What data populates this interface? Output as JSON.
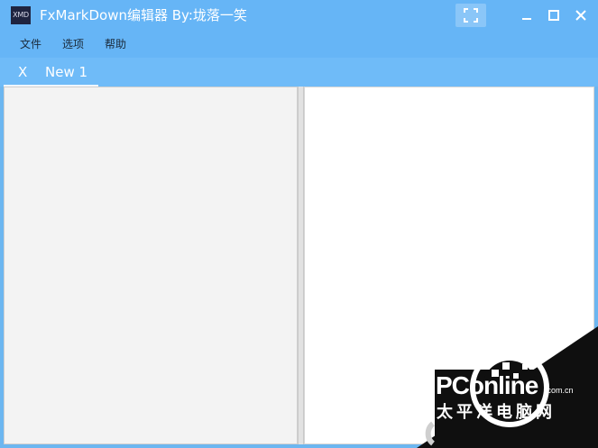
{
  "window": {
    "icon_text": "XMD",
    "title": "FxMarkDown编辑器  By:垅落一笑"
  },
  "menu": {
    "items": [
      "文件",
      "选项",
      "帮助"
    ]
  },
  "tabs": [
    {
      "close_label": "X",
      "label": "New 1"
    }
  ],
  "watermark": {
    "brand": "PConline",
    "domain": ".com.cn",
    "cn_text": "太平洋电脑网"
  },
  "colors": {
    "titlebar": "#66b5f6",
    "tabbar": "#6fbbf8",
    "editor_bg": "#f3f3f3",
    "preview_bg": "#ffffff"
  }
}
